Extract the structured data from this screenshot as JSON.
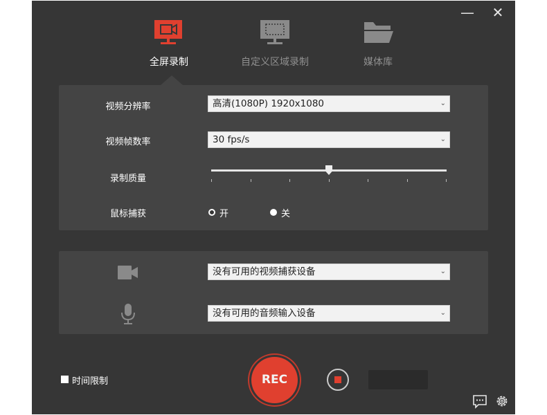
{
  "window": {
    "minimize_symbol": "—",
    "close_symbol": "✕"
  },
  "tabs": [
    {
      "label": "全屏录制",
      "icon": "monitor-record-icon",
      "active": true
    },
    {
      "label": "自定义区域录制",
      "icon": "region-select-icon",
      "active": false
    },
    {
      "label": "媒体库",
      "icon": "folder-icon",
      "active": false
    }
  ],
  "settings": {
    "resolution": {
      "label": "视频分辨率",
      "value": "高清(1080P)   1920x1080"
    },
    "framerate": {
      "label": "视频帧数率",
      "value": "30 fps/s"
    },
    "quality": {
      "label": "录制质量",
      "level_fraction": 0.5
    },
    "mouse_capture": {
      "label": "鼠标捕获",
      "options": [
        "开",
        "关"
      ],
      "selected": "开"
    }
  },
  "devices": {
    "video": {
      "icon": "camera-icon",
      "value": "没有可用的视频捕获设备"
    },
    "audio": {
      "icon": "microphone-icon",
      "value": "没有可用的音频输入设备"
    }
  },
  "bottom": {
    "time_limit_label": "时间限制",
    "time_limit_checked": false,
    "rec_label": "REC",
    "icons": [
      "feedback-icon",
      "gear-icon"
    ]
  },
  "colors": {
    "accent": "#e0402f",
    "background": "#363636",
    "panel": "#444444"
  },
  "dropdown_arrow": "⌄"
}
